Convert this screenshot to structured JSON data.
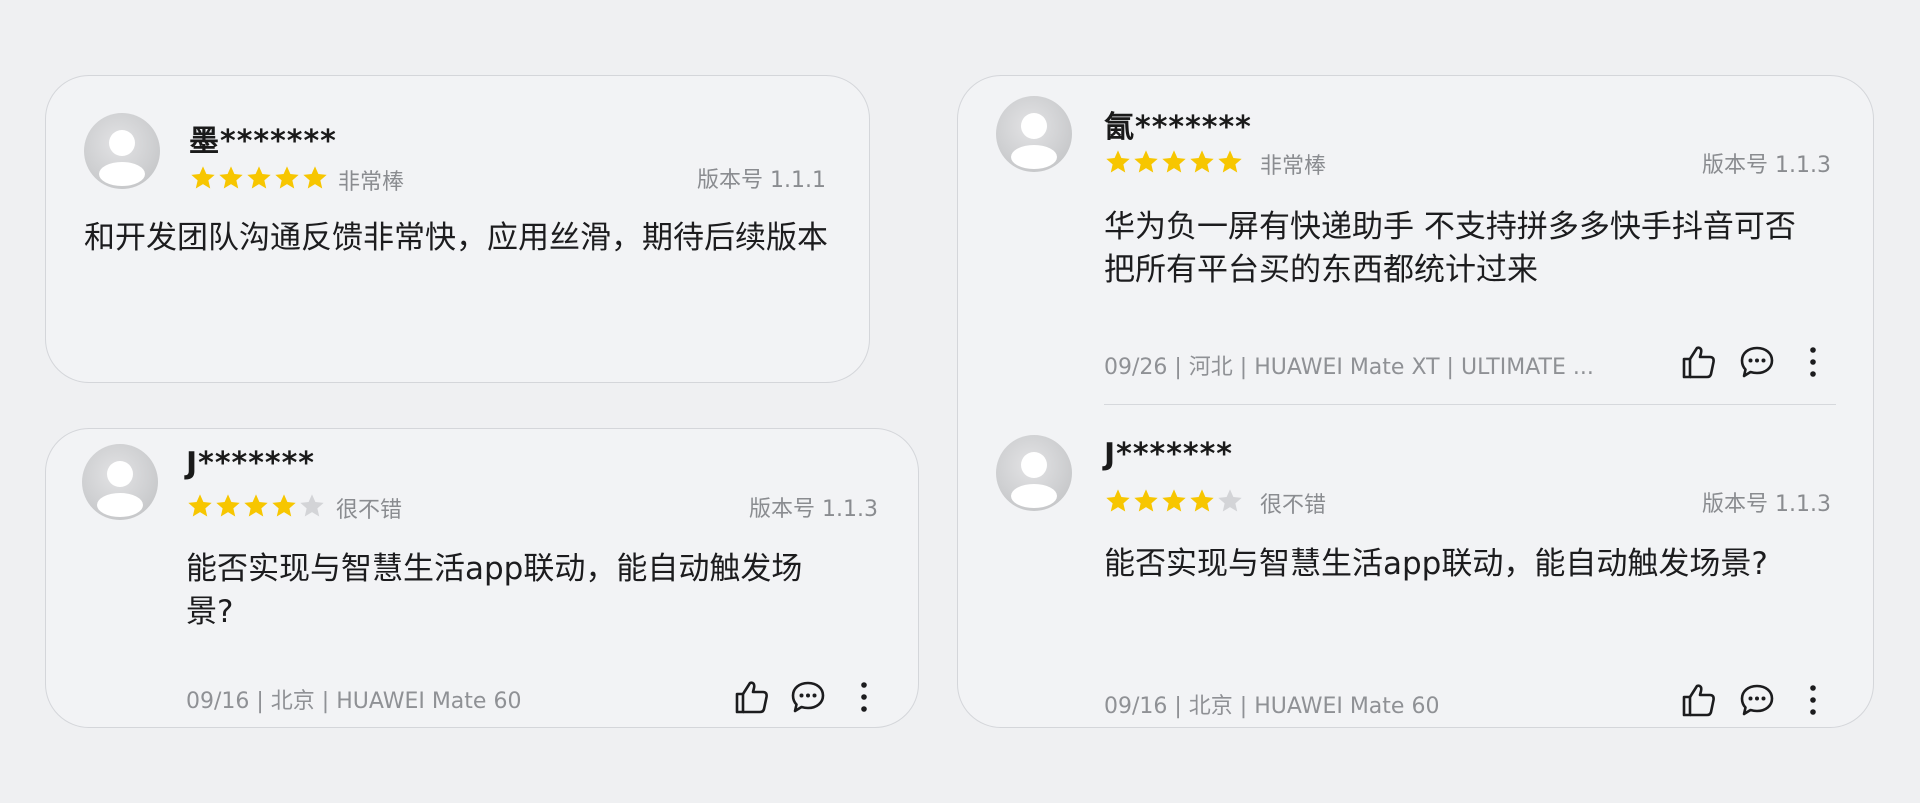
{
  "colors": {
    "star_on": "#f7c600",
    "star_off": "#d3d4d7",
    "muted_text": "#8a8c90",
    "background": "#eff0f2"
  },
  "cards": {
    "card1": {
      "user": "墨*******",
      "rating": 5,
      "rating_label": "非常棒",
      "version": "版本号 1.1.1",
      "text": "和开发团队沟通反馈非常快，应用丝滑，期待后续版本"
    },
    "card2": {
      "user": "J*******",
      "rating": 4,
      "rating_label": "很不错",
      "version": "版本号 1.1.3",
      "text": "能否实现与智慧生活app联动，能自动触发场景?",
      "meta": "09/16 | 北京 | HUAWEI Mate 60"
    },
    "card3": {
      "review1": {
        "user": "氤*******",
        "rating": 5,
        "rating_label": "非常棒",
        "version": "版本号 1.1.3",
        "text": "华为负一屏有快递助手 不支持拼多多快手抖音可否把所有平台买的东西都统计过来",
        "meta": "09/26 | 河北 | HUAWEI Mate XT | ULTIMATE ..."
      },
      "review2": {
        "user": "J*******",
        "rating": 4,
        "rating_label": "很不错",
        "version": "版本号 1.1.3",
        "text": "能否实现与智慧生活app联动，能自动触发场景?",
        "meta": "09/16 | 北京 | HUAWEI Mate 60"
      }
    }
  },
  "icons": {
    "avatar": "default-avatar-icon",
    "star": "star-icon",
    "like": "thumbs-up-icon",
    "comment": "comment-icon",
    "more": "more-vertical-icon"
  }
}
